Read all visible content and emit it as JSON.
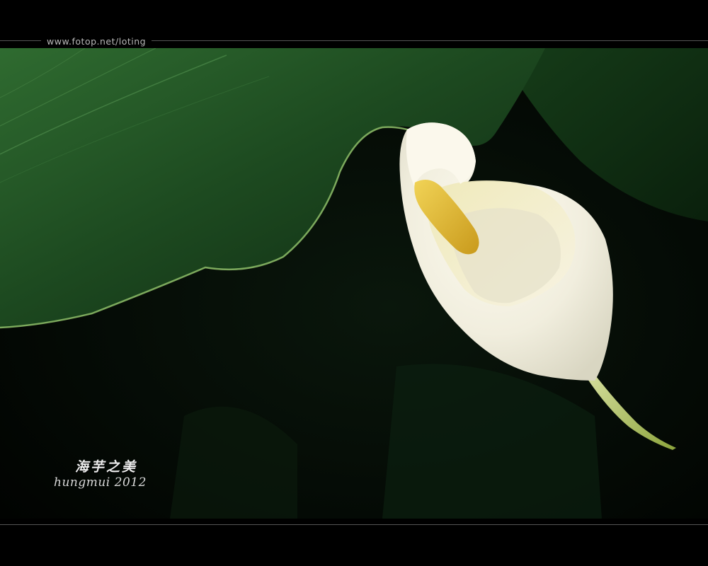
{
  "header": {
    "site_url": "www.fotop.net/loting"
  },
  "signature": {
    "chinese": "海芋之美",
    "english": "hungmui 2012"
  },
  "colors": {
    "background": "#000000",
    "rule": "#555555",
    "leaf": "#1f4a22",
    "flower": "#f4f1e6",
    "spadix": "#e8c23a"
  }
}
